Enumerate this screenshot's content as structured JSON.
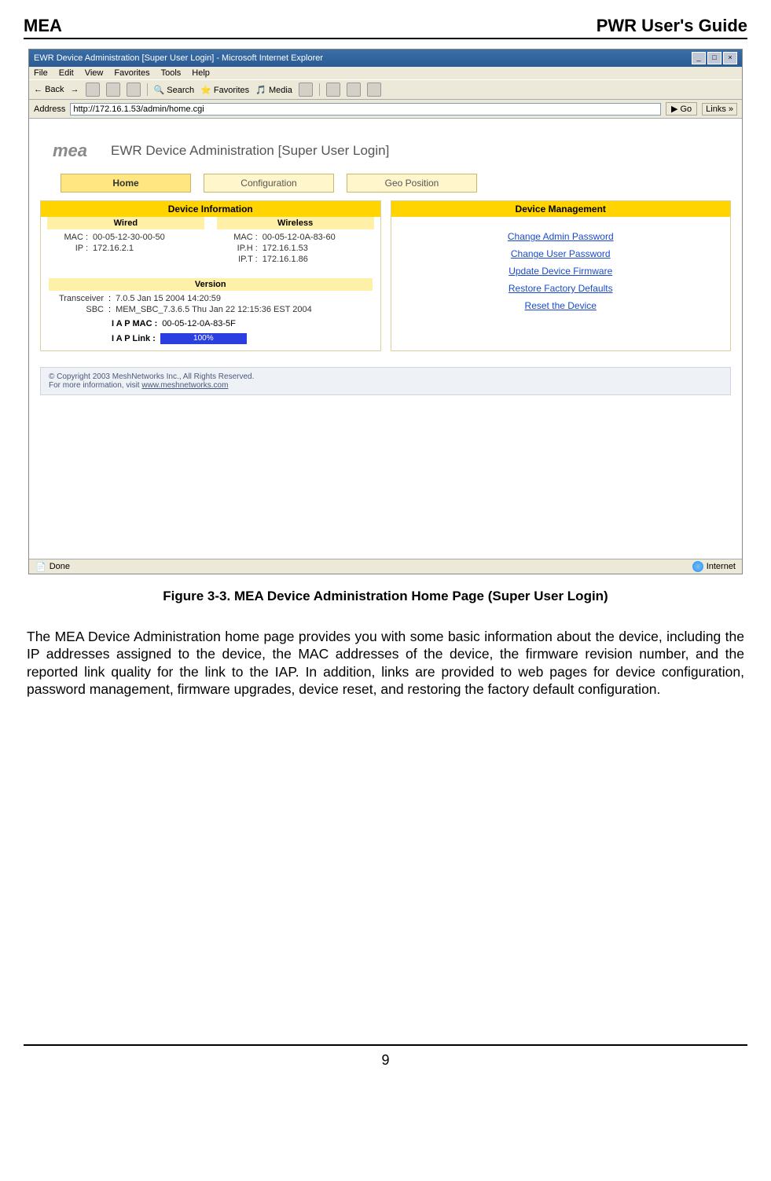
{
  "doc": {
    "header_left": "MEA",
    "header_right": "PWR User's Guide",
    "figure_caption": "Figure 3-3.     MEA Device Administration Home Page (Super User Login)",
    "paragraph": "The MEA Device Administration home page provides you with some basic information about the device, including the IP addresses assigned to the device, the MAC addresses of the device, the firmware revision number, and the reported link quality for the link to the IAP. In addition, links are provided to web pages for device configuration, password management, firmware upgrades, device reset, and restoring the factory default configuration.",
    "page_number": "9"
  },
  "win": {
    "title": "EWR Device Administration [Super User Login] - Microsoft Internet Explorer",
    "menu": [
      "File",
      "Edit",
      "View",
      "Favorites",
      "Tools",
      "Help"
    ],
    "toolbar": {
      "back": "Back",
      "search": "Search",
      "favorites": "Favorites",
      "media": "Media"
    },
    "address_label": "Address",
    "address_value": "http://172.16.1.53/admin/home.cgi",
    "go": "Go",
    "links": "Links »",
    "status_left": "Done",
    "status_right": "Internet"
  },
  "page": {
    "logo_text": "mea",
    "title": "EWR Device Administration [Super User Login]",
    "tabs": {
      "home": "Home",
      "config": "Configuration",
      "geo": "Geo Position"
    },
    "left_panel": {
      "header": "Device Information",
      "wired_hdr": "Wired",
      "wireless_hdr": "Wireless",
      "wired": {
        "mac_k": "MAC :",
        "mac_v": "00-05-12-30-00-50",
        "ip_k": "IP :",
        "ip_v": "172.16.2.1"
      },
      "wireless": {
        "mac_k": "MAC :",
        "mac_v": "00-05-12-0A-83-60",
        "iph_k": "IP.H :",
        "iph_v": "172.16.1.53",
        "ipt_k": "IP.T :",
        "ipt_v": "172.16.1.86"
      },
      "version_hdr": "Version",
      "version": {
        "trans_k": "Transceiver",
        "trans_v": "7.0.5 Jan 15 2004 14:20:59",
        "sbc_k": "SBC",
        "sbc_v": "MEM_SBC_7.3.6.5 Thu Jan 22 12:15:36 EST 2004"
      },
      "iap_mac_label": "I A P MAC :",
      "iap_mac_value": "00-05-12-0A-83-5F",
      "iap_link_label": "I A P Link :",
      "iap_link_value": "100%"
    },
    "right_panel": {
      "header": "Device Management",
      "links": [
        "Change Admin Password",
        "Change User Password",
        "Update Device Firmware",
        "Restore Factory Defaults",
        "Reset the Device"
      ]
    },
    "copyright_line1": "© Copyright 2003 MeshNetworks Inc., All Rights Reserved.",
    "copyright_line2_prefix": "For more information, visit ",
    "copyright_link": "www.meshnetworks.com"
  }
}
